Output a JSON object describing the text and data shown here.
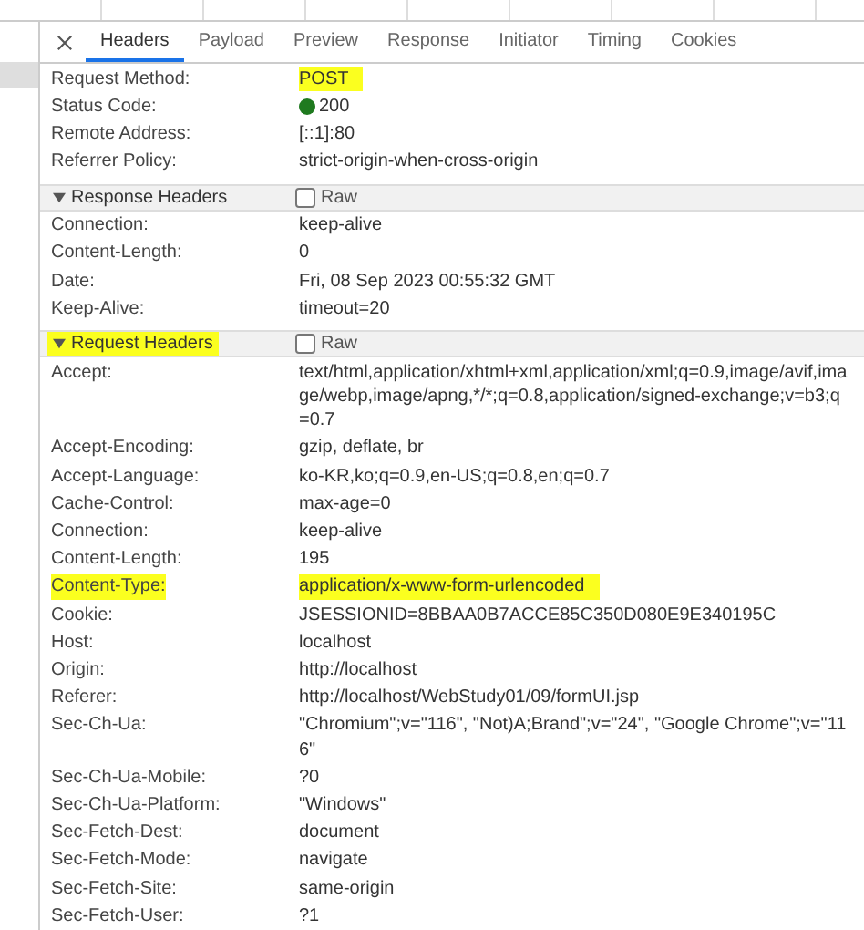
{
  "tabs": [
    {
      "label": "Headers",
      "selected": true
    },
    {
      "label": "Payload",
      "selected": false
    },
    {
      "label": "Preview",
      "selected": false
    },
    {
      "label": "Response",
      "selected": false
    },
    {
      "label": "Initiator",
      "selected": false
    },
    {
      "label": "Timing",
      "selected": false
    },
    {
      "label": "Cookies",
      "selected": false
    }
  ],
  "general": [
    {
      "name": "Request Method:",
      "value": "POST",
      "kind": "text",
      "name_highlighted": false,
      "value_highlighted": true
    },
    {
      "name": "Status Code:",
      "value": "200",
      "kind": "status",
      "name_highlighted": false,
      "value_highlighted": false
    },
    {
      "name": "Remote Address:",
      "value": "[::1]:80",
      "kind": "text",
      "name_highlighted": false,
      "value_highlighted": false
    },
    {
      "name": "Referrer Policy:",
      "value": "strict-origin-when-cross-origin",
      "kind": "text",
      "name_highlighted": false,
      "value_highlighted": false
    }
  ],
  "sections": [
    {
      "title": "Response Headers",
      "expanded": true,
      "highlighted": false,
      "raw_label": "Raw",
      "raw_checked": false,
      "rows": [
        {
          "name": "Connection:",
          "value": "keep-alive",
          "name_highlighted": false,
          "value_highlighted": false
        },
        {
          "name": "Content-Length:",
          "value": "0",
          "name_highlighted": false,
          "value_highlighted": false
        },
        {
          "name": "Date:",
          "value": "Fri, 08 Sep 2023 00:55:32 GMT",
          "name_highlighted": false,
          "value_highlighted": false
        },
        {
          "name": "Keep-Alive:",
          "value": "timeout=20",
          "name_highlighted": false,
          "value_highlighted": false
        }
      ]
    },
    {
      "title": "Request Headers",
      "expanded": true,
      "highlighted": true,
      "raw_label": "Raw",
      "raw_checked": false,
      "rows": [
        {
          "name": "Accept:",
          "value": "text/html,application/xhtml+xml,application/xml;q=0.9,image/avif,image/webp,image/apng,*/*;q=0.8,application/signed-exchange;v=b3;q=0.7",
          "name_highlighted": false,
          "value_highlighted": false
        },
        {
          "name": "Accept-Encoding:",
          "value": "gzip, deflate, br",
          "name_highlighted": false,
          "value_highlighted": false
        },
        {
          "name": "Accept-Language:",
          "value": "ko-KR,ko;q=0.9,en-US;q=0.8,en;q=0.7",
          "name_highlighted": false,
          "value_highlighted": false
        },
        {
          "name": "Cache-Control:",
          "value": "max-age=0",
          "name_highlighted": false,
          "value_highlighted": false
        },
        {
          "name": "Connection:",
          "value": "keep-alive",
          "name_highlighted": false,
          "value_highlighted": false
        },
        {
          "name": "Content-Length:",
          "value": "195",
          "name_highlighted": false,
          "value_highlighted": false
        },
        {
          "name": "Content-Type:",
          "value": "application/x-www-form-urlencoded",
          "name_highlighted": true,
          "value_highlighted": true
        },
        {
          "name": "Cookie:",
          "value": "JSESSIONID=8BBAA0B7ACCE85C350D080E9E340195C",
          "name_highlighted": false,
          "value_highlighted": false
        },
        {
          "name": "Host:",
          "value": "localhost",
          "name_highlighted": false,
          "value_highlighted": false
        },
        {
          "name": "Origin:",
          "value": "http://localhost",
          "name_highlighted": false,
          "value_highlighted": false
        },
        {
          "name": "Referer:",
          "value": "http://localhost/WebStudy01/09/formUI.jsp",
          "name_highlighted": false,
          "value_highlighted": false
        },
        {
          "name": "Sec-Ch-Ua:",
          "value": "\"Chromium\";v=\"116\", \"Not)A;Brand\";v=\"24\", \"Google Chrome\";v=\"116\"",
          "name_highlighted": false,
          "value_highlighted": false
        },
        {
          "name": "Sec-Ch-Ua-Mobile:",
          "value": "?0",
          "name_highlighted": false,
          "value_highlighted": false
        },
        {
          "name": "Sec-Ch-Ua-Platform:",
          "value": "\"Windows\"",
          "name_highlighted": false,
          "value_highlighted": false
        },
        {
          "name": "Sec-Fetch-Dest:",
          "value": "document",
          "name_highlighted": false,
          "value_highlighted": false
        },
        {
          "name": "Sec-Fetch-Mode:",
          "value": "navigate",
          "name_highlighted": false,
          "value_highlighted": false
        },
        {
          "name": "Sec-Fetch-Site:",
          "value": "same-origin",
          "name_highlighted": false,
          "value_highlighted": false
        },
        {
          "name": "Sec-Fetch-User:",
          "value": "?1",
          "name_highlighted": false,
          "value_highlighted": false
        }
      ]
    }
  ]
}
